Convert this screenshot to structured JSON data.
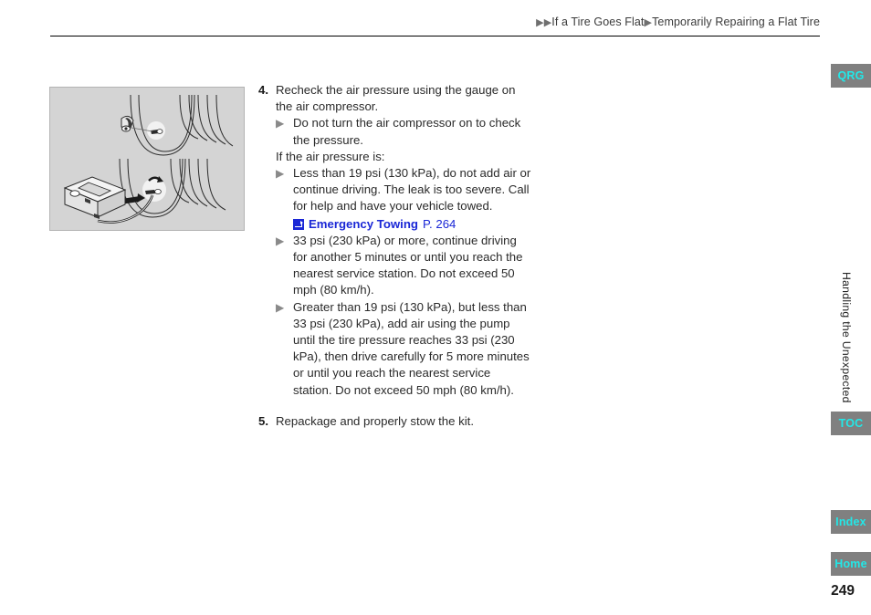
{
  "header": {
    "breadcrumb_marker_double": "▶▶",
    "breadcrumb_marker_single": "▶",
    "breadcrumb_parent": "If a Tire Goes Flat",
    "breadcrumb_current": "Temporarily Repairing a Flat Tire"
  },
  "figure": {
    "caption": "",
    "alt_name": "tire-valve-and-air-compressor-illustration"
  },
  "content": {
    "bullet_marker": "▶",
    "step4": {
      "number": "4.",
      "text": "Recheck the air pressure using the gauge on the air compressor.",
      "bullet1": "Do not turn the air compressor on to check the pressure.",
      "lead_in": "If the air pressure is:",
      "bullet2": "Less than 19 psi (130 kPa), do not add air or continue driving. The leak is too severe. Call for help and have your vehicle towed.",
      "reference": {
        "icon": "jump-link-icon",
        "title": "Emergency Towing",
        "page": "P. 264"
      },
      "bullet3": "33 psi (230 kPa) or more, continue driving for another 5 minutes or until you reach the nearest service station. Do not exceed 50 mph (80 km/h).",
      "bullet4": "Greater than 19 psi (130 kPa), but less than 33 psi (230 kPa), add air using the pump until the tire pressure reaches 33 psi (230 kPa), then drive carefully for 5 more minutes or until you reach the nearest service station. Do not exceed 50 mph (80 km/h)."
    },
    "step5": {
      "number": "5.",
      "text": "Repackage and properly stow the kit."
    }
  },
  "sidebar": {
    "qrg_label": "QRG",
    "toc_label": "TOC",
    "index_label": "Index",
    "home_label": "Home",
    "chapter_label": "Handling the Unexpected"
  },
  "footer": {
    "page_number": "249"
  },
  "colors": {
    "link": "#1a27d6",
    "sidebar_button_bg": "#808080",
    "sidebar_button_text": "#22e8e8",
    "figure_bg": "#d4d4d4",
    "bullet_triangle": "#8a8a8a"
  }
}
